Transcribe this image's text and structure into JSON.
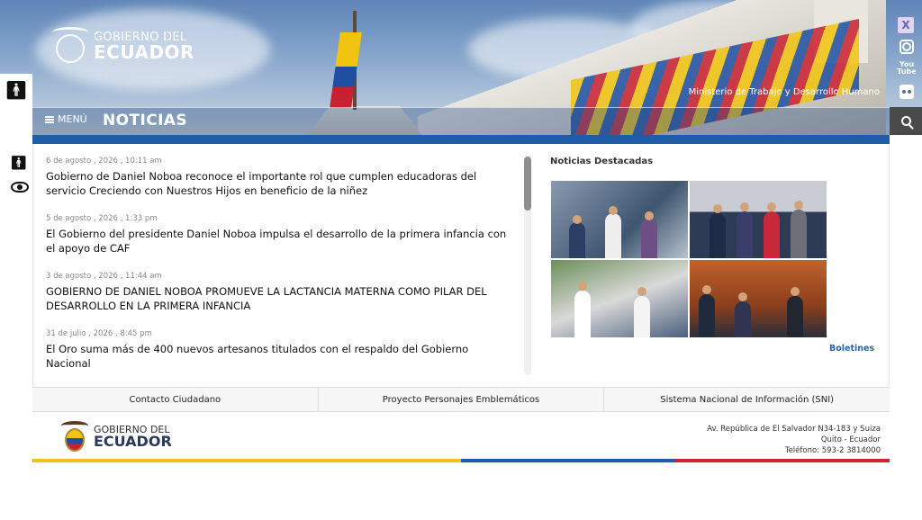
{
  "header": {
    "logo_line1": "GOBIERNO DEL",
    "logo_line2": "ECUADOR",
    "ministry": "Ministerio de Trabajo y Desarrollo Humano",
    "menu_label": "MENÚ",
    "section_title": "NOTICIAS"
  },
  "social": {
    "icons": [
      "x-icon",
      "instagram-icon",
      "youtube-icon",
      "flickr-icon"
    ],
    "youtube_line1": "You",
    "youtube_line2": "Tube"
  },
  "news": [
    {
      "date": "6 de agosto , 2026 , 10:11 am",
      "title": "Gobierno de Daniel Noboa reconoce el importante rol que cumplen educadoras del servicio Creciendo con Nuestros Hijos en beneficio de la niñez"
    },
    {
      "date": "5 de agosto , 2026 , 1:33 pm",
      "title": "El Gobierno del presidente Daniel Noboa impulsa el desarrollo de la primera infancia con el apoyo de CAF"
    },
    {
      "date": "3 de agosto , 2026 , 11:44 am",
      "title": "GOBIERNO DE DANIEL NOBOA PROMUEVE LA LACTANCIA MATERNA COMO PILAR DEL DESARROLLO EN LA PRIMERA INFANCIA"
    },
    {
      "date": "31 de julio , 2026 , 8:45 pm",
      "title": "El Oro suma más de 400 nuevos artesanos titulados con el respaldo del Gobierno Nacional"
    }
  ],
  "featured": {
    "title": "Noticias Destacadas",
    "more_link": "Boletines"
  },
  "footer": {
    "links": [
      "Contacto Ciudadano",
      "Proyecto Personajes Emblemáticos",
      "Sistema Nacional de Información (SNI)"
    ],
    "logo_line1": "GOBIERNO DEL",
    "logo_line2": "ECUADOR",
    "address_line1": "Av. República de El Salvador N34-183 y Suiza",
    "address_line2": "Quito - Ecuador",
    "address_line3": "Teléfono: 593-2 3814000"
  },
  "colors": {
    "primary_blue": "#1f5ca8",
    "flag_yellow": "#f2c316",
    "flag_red": "#d3222f",
    "link_blue": "#2a63a8"
  }
}
